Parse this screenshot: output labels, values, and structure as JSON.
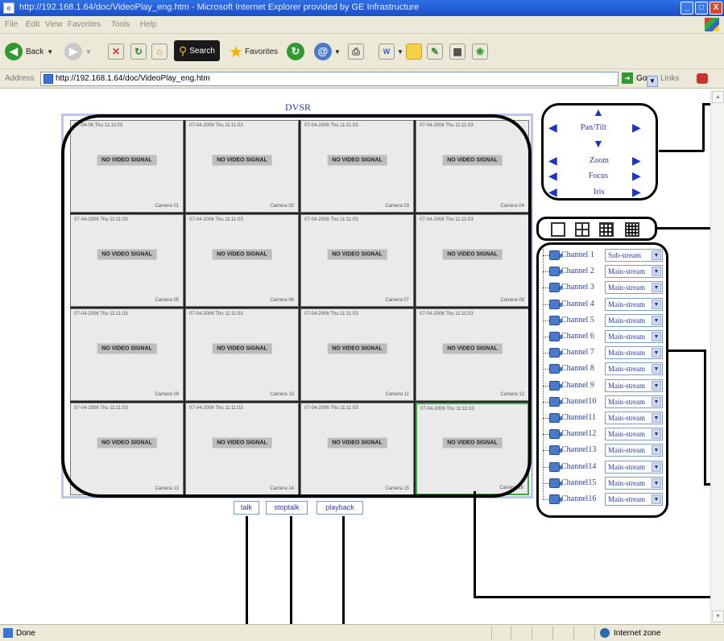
{
  "window": {
    "title": "http://192.168.1.64/doc/VideoPlay_eng.htm - Microsoft Internet Explorer provided by GE Infrastructure",
    "min": "_",
    "max": "□",
    "close": "X"
  },
  "menubar": [
    "File",
    "Edit",
    "View",
    "Favorites",
    "Tools",
    "Help"
  ],
  "toolbar": {
    "back": "Back",
    "search": "Search",
    "favorites": "Favorites"
  },
  "address": {
    "label": "Address",
    "url": "http://192.168.1.64/doc/VideoPlay_eng.htm",
    "go": "Go",
    "links": "Links"
  },
  "status": {
    "left": "Done",
    "zone": "Internet zone"
  },
  "page": {
    "title": "DVSR",
    "no_signal": "NO VIDEO SIGNAL",
    "cameras": [
      {
        "ts": "07-04-06 Thu 11:11:03",
        "label": "Camera 01"
      },
      {
        "ts": "07-04-2006 Thu 11:11:03",
        "label": "Camera 02"
      },
      {
        "ts": "07-04-2006 Thu 11:11:03",
        "label": "Camera 03"
      },
      {
        "ts": "07-04-2006 Thu 11:11:03",
        "label": "Camera 04"
      },
      {
        "ts": "07-04-2006 Thu 11:11:03",
        "label": "Camera 05"
      },
      {
        "ts": "07-04-2006 Thu 11:11:03",
        "label": "Camera 06"
      },
      {
        "ts": "07-04-2006 Thu 11:11:03",
        "label": "Camera 07"
      },
      {
        "ts": "07-04-2006 Thu 11:11:03",
        "label": "Camera 08"
      },
      {
        "ts": "07-04-2006 Thu 11:11:03",
        "label": "Camera 09"
      },
      {
        "ts": "07-04-2006 Thu 11:11:03",
        "label": "Camera 10"
      },
      {
        "ts": "07-04-2006 Thu 11:11:03",
        "label": "Camera 11"
      },
      {
        "ts": "07-04-2006 Thu 11:11:03",
        "label": "Camera 12"
      },
      {
        "ts": "07-04-2006 Thu 11:11:03",
        "label": "Camera 13"
      },
      {
        "ts": "07-04-2006 Thu 11:11:03",
        "label": "Camera 14"
      },
      {
        "ts": "07-04-2006 Thu 11:11:03",
        "label": "Camera 15"
      },
      {
        "ts": "07-04-2006 Thu 11:11:03",
        "label": "Camera 16"
      }
    ],
    "buttons": {
      "talk": "talk",
      "stoptalk": "stoptalk",
      "playback": "playback"
    }
  },
  "ptz": {
    "pan_tilt": "Pan/Tilt",
    "zoom": "Zoom",
    "focus": "Focus",
    "iris": "Iris"
  },
  "channels": [
    {
      "name": "Channel 1",
      "stream": "Sub-stream"
    },
    {
      "name": "Channel 2",
      "stream": "Main-stream"
    },
    {
      "name": "Channel 3",
      "stream": "Main-stream"
    },
    {
      "name": "Channel 4",
      "stream": "Main-stream"
    },
    {
      "name": "Channel 5",
      "stream": "Main-stream"
    },
    {
      "name": "Channel 6",
      "stream": "Main-stream"
    },
    {
      "name": "Channel 7",
      "stream": "Main-stream"
    },
    {
      "name": "Channel 8",
      "stream": "Main-stream"
    },
    {
      "name": "Channel 9",
      "stream": "Main-stream"
    },
    {
      "name": "Channel10",
      "stream": "Main-stream"
    },
    {
      "name": "Channel11",
      "stream": "Main-stream"
    },
    {
      "name": "Channel12",
      "stream": "Main-stream"
    },
    {
      "name": "Channel13",
      "stream": "Main-stream"
    },
    {
      "name": "Channel14",
      "stream": "Main-stream"
    },
    {
      "name": "Channel15",
      "stream": "Main-stream"
    },
    {
      "name": "Channel16",
      "stream": "Main-stream"
    }
  ],
  "colors": {
    "accent": "#2b3aa0",
    "arrow": "#1f35c7",
    "titlebar": "#1b4fc7",
    "selected_cell": "#3caa3c"
  }
}
